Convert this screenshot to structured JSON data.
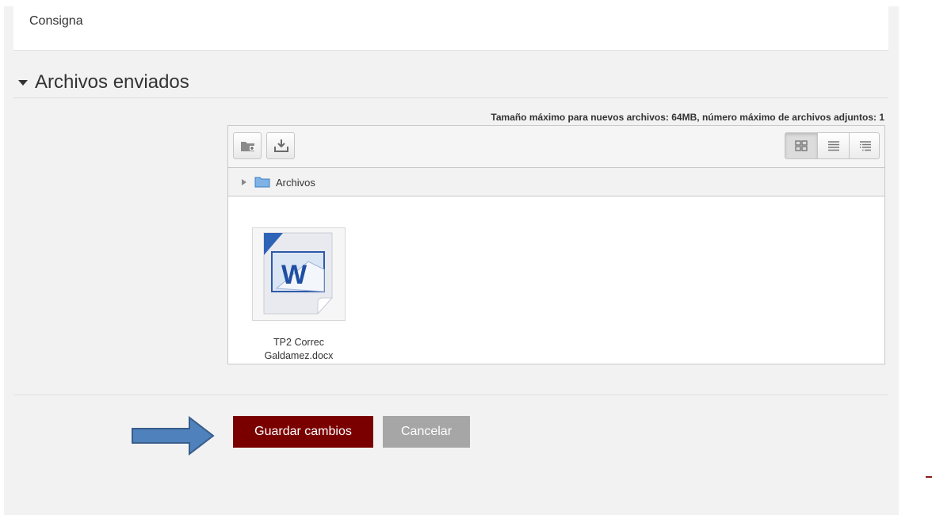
{
  "consigna": {
    "label": "Consigna"
  },
  "section": {
    "title": "Archivos enviados"
  },
  "filepicker": {
    "limits": "Tamaño máximo para nuevos archivos: 64MB, número máximo de archivos adjuntos: 1",
    "toolbar": {
      "left_buttons": [
        "add-folder-icon",
        "download-icon"
      ],
      "views": [
        "icons-view-icon",
        "list-view-icon",
        "tree-view-icon"
      ],
      "active_view": "icons"
    },
    "path": {
      "folder": "Archivos"
    },
    "files": [
      {
        "name": "TP2 Correc Galdamez.docx",
        "icon": "word-document-icon"
      }
    ]
  },
  "actions": {
    "save_label": "Guardar cambios",
    "cancel_label": "Cancelar"
  },
  "colors": {
    "save": "#7a0000",
    "cancel": "#a6a6a6",
    "panel_bg": "#f2f2f2",
    "annotation_arrow": "#4f81bd"
  }
}
